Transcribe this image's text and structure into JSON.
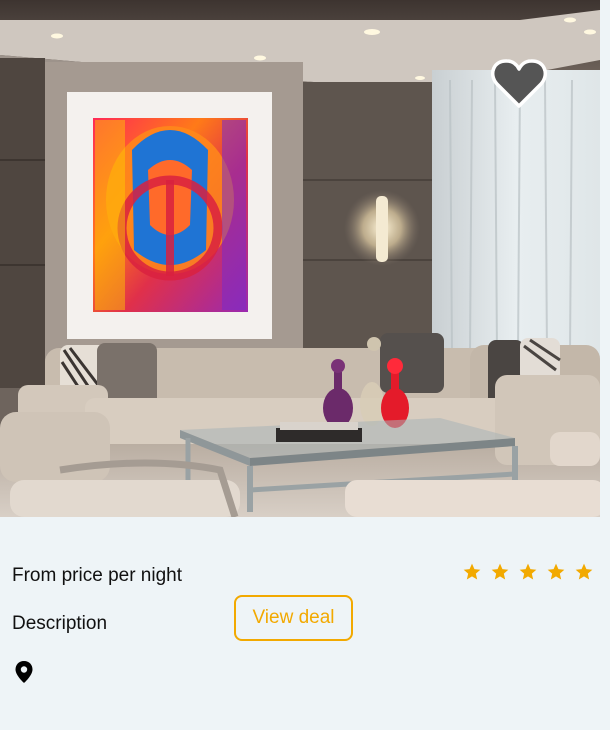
{
  "listing": {
    "price_label": "From price per night",
    "description_label": "Description",
    "cta_label": "View deal",
    "rating": 5,
    "rating_max": 5
  },
  "icons": {
    "favorite": "heart-outline-icon",
    "location": "location-pin-icon",
    "rating": "star-icon"
  },
  "colors": {
    "accent": "#f2a900",
    "card_background": "#eef4f7",
    "text": "#111111"
  }
}
